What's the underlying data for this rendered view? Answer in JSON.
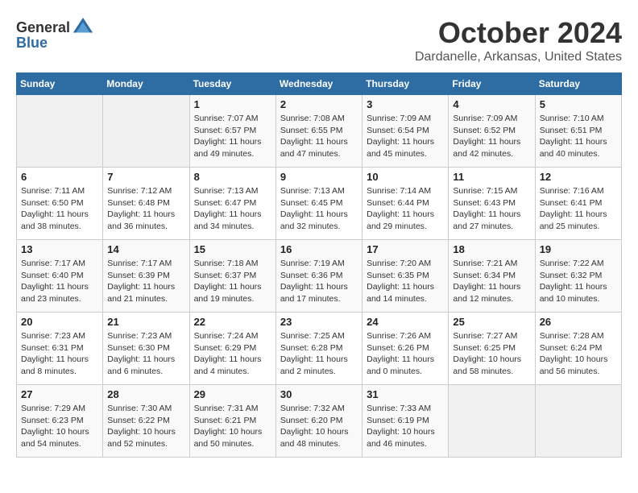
{
  "header": {
    "logo_general": "General",
    "logo_blue": "Blue",
    "month_title": "October 2024",
    "location": "Dardanelle, Arkansas, United States"
  },
  "days_of_week": [
    "Sunday",
    "Monday",
    "Tuesday",
    "Wednesday",
    "Thursday",
    "Friday",
    "Saturday"
  ],
  "weeks": [
    [
      {
        "day": "",
        "info": ""
      },
      {
        "day": "",
        "info": ""
      },
      {
        "day": "1",
        "info": "Sunrise: 7:07 AM\nSunset: 6:57 PM\nDaylight: 11 hours and 49 minutes."
      },
      {
        "day": "2",
        "info": "Sunrise: 7:08 AM\nSunset: 6:55 PM\nDaylight: 11 hours and 47 minutes."
      },
      {
        "day": "3",
        "info": "Sunrise: 7:09 AM\nSunset: 6:54 PM\nDaylight: 11 hours and 45 minutes."
      },
      {
        "day": "4",
        "info": "Sunrise: 7:09 AM\nSunset: 6:52 PM\nDaylight: 11 hours and 42 minutes."
      },
      {
        "day": "5",
        "info": "Sunrise: 7:10 AM\nSunset: 6:51 PM\nDaylight: 11 hours and 40 minutes."
      }
    ],
    [
      {
        "day": "6",
        "info": "Sunrise: 7:11 AM\nSunset: 6:50 PM\nDaylight: 11 hours and 38 minutes."
      },
      {
        "day": "7",
        "info": "Sunrise: 7:12 AM\nSunset: 6:48 PM\nDaylight: 11 hours and 36 minutes."
      },
      {
        "day": "8",
        "info": "Sunrise: 7:13 AM\nSunset: 6:47 PM\nDaylight: 11 hours and 34 minutes."
      },
      {
        "day": "9",
        "info": "Sunrise: 7:13 AM\nSunset: 6:45 PM\nDaylight: 11 hours and 32 minutes."
      },
      {
        "day": "10",
        "info": "Sunrise: 7:14 AM\nSunset: 6:44 PM\nDaylight: 11 hours and 29 minutes."
      },
      {
        "day": "11",
        "info": "Sunrise: 7:15 AM\nSunset: 6:43 PM\nDaylight: 11 hours and 27 minutes."
      },
      {
        "day": "12",
        "info": "Sunrise: 7:16 AM\nSunset: 6:41 PM\nDaylight: 11 hours and 25 minutes."
      }
    ],
    [
      {
        "day": "13",
        "info": "Sunrise: 7:17 AM\nSunset: 6:40 PM\nDaylight: 11 hours and 23 minutes."
      },
      {
        "day": "14",
        "info": "Sunrise: 7:17 AM\nSunset: 6:39 PM\nDaylight: 11 hours and 21 minutes."
      },
      {
        "day": "15",
        "info": "Sunrise: 7:18 AM\nSunset: 6:37 PM\nDaylight: 11 hours and 19 minutes."
      },
      {
        "day": "16",
        "info": "Sunrise: 7:19 AM\nSunset: 6:36 PM\nDaylight: 11 hours and 17 minutes."
      },
      {
        "day": "17",
        "info": "Sunrise: 7:20 AM\nSunset: 6:35 PM\nDaylight: 11 hours and 14 minutes."
      },
      {
        "day": "18",
        "info": "Sunrise: 7:21 AM\nSunset: 6:34 PM\nDaylight: 11 hours and 12 minutes."
      },
      {
        "day": "19",
        "info": "Sunrise: 7:22 AM\nSunset: 6:32 PM\nDaylight: 11 hours and 10 minutes."
      }
    ],
    [
      {
        "day": "20",
        "info": "Sunrise: 7:23 AM\nSunset: 6:31 PM\nDaylight: 11 hours and 8 minutes."
      },
      {
        "day": "21",
        "info": "Sunrise: 7:23 AM\nSunset: 6:30 PM\nDaylight: 11 hours and 6 minutes."
      },
      {
        "day": "22",
        "info": "Sunrise: 7:24 AM\nSunset: 6:29 PM\nDaylight: 11 hours and 4 minutes."
      },
      {
        "day": "23",
        "info": "Sunrise: 7:25 AM\nSunset: 6:28 PM\nDaylight: 11 hours and 2 minutes."
      },
      {
        "day": "24",
        "info": "Sunrise: 7:26 AM\nSunset: 6:26 PM\nDaylight: 11 hours and 0 minutes."
      },
      {
        "day": "25",
        "info": "Sunrise: 7:27 AM\nSunset: 6:25 PM\nDaylight: 10 hours and 58 minutes."
      },
      {
        "day": "26",
        "info": "Sunrise: 7:28 AM\nSunset: 6:24 PM\nDaylight: 10 hours and 56 minutes."
      }
    ],
    [
      {
        "day": "27",
        "info": "Sunrise: 7:29 AM\nSunset: 6:23 PM\nDaylight: 10 hours and 54 minutes."
      },
      {
        "day": "28",
        "info": "Sunrise: 7:30 AM\nSunset: 6:22 PM\nDaylight: 10 hours and 52 minutes."
      },
      {
        "day": "29",
        "info": "Sunrise: 7:31 AM\nSunset: 6:21 PM\nDaylight: 10 hours and 50 minutes."
      },
      {
        "day": "30",
        "info": "Sunrise: 7:32 AM\nSunset: 6:20 PM\nDaylight: 10 hours and 48 minutes."
      },
      {
        "day": "31",
        "info": "Sunrise: 7:33 AM\nSunset: 6:19 PM\nDaylight: 10 hours and 46 minutes."
      },
      {
        "day": "",
        "info": ""
      },
      {
        "day": "",
        "info": ""
      }
    ]
  ]
}
